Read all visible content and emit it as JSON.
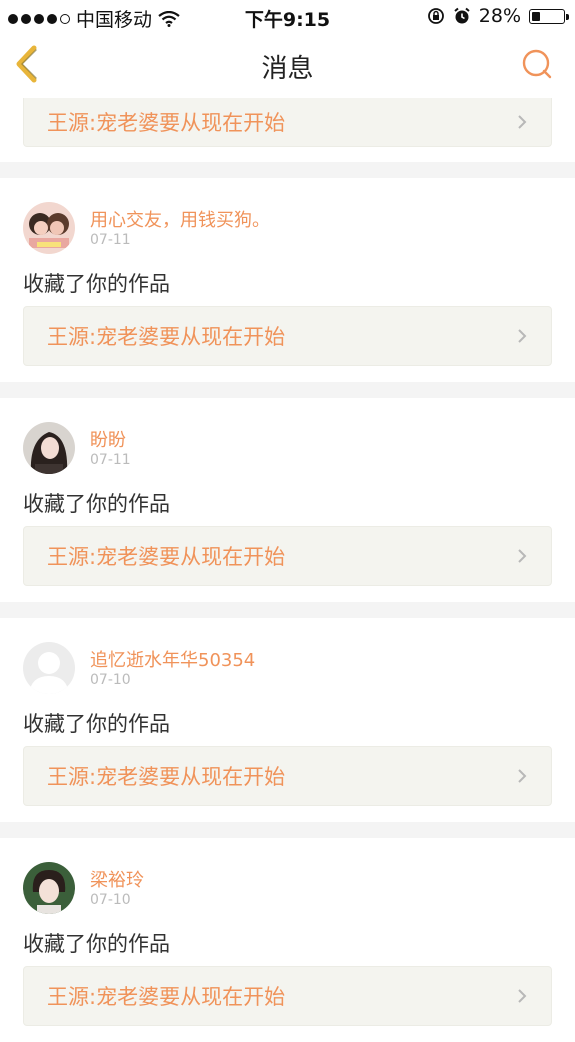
{
  "status_bar": {
    "carrier": "中国移动",
    "time": "下午9:15",
    "battery": "28%",
    "battery_level": 0.28
  },
  "nav": {
    "title": "消息",
    "back_icon": "back-chevron-icon",
    "search_icon": "search-icon"
  },
  "first_card": {
    "link_text": "王源:宠老婆要从现在开始"
  },
  "items": [
    {
      "username": "用心交友，用钱买狗。",
      "date": "07-11",
      "action": "收藏了你的作品",
      "link_text": "王源:宠老婆要从现在开始",
      "avatar_color": "#d9a59a"
    },
    {
      "username": "盼盼",
      "date": "07-11",
      "action": "收藏了你的作品",
      "link_text": "王源:宠老婆要从现在开始",
      "avatar_color": "#5a4a44"
    },
    {
      "username": "追忆逝水年华50354",
      "date": "07-10",
      "action": "收藏了你的作品",
      "link_text": "王源:宠老婆要从现在开始",
      "avatar_color": "#e8e8e8"
    },
    {
      "username": "梁裕玲",
      "date": "07-10",
      "action": "收藏了你的作品",
      "link_text": "王源:宠老婆要从现在开始",
      "avatar_color": "#3b5f3a"
    }
  ],
  "colors": {
    "accent": "#f0935a",
    "link_bg": "#f4f4ef",
    "date": "#bbbbbb",
    "back_icon": "#e8b53a"
  }
}
